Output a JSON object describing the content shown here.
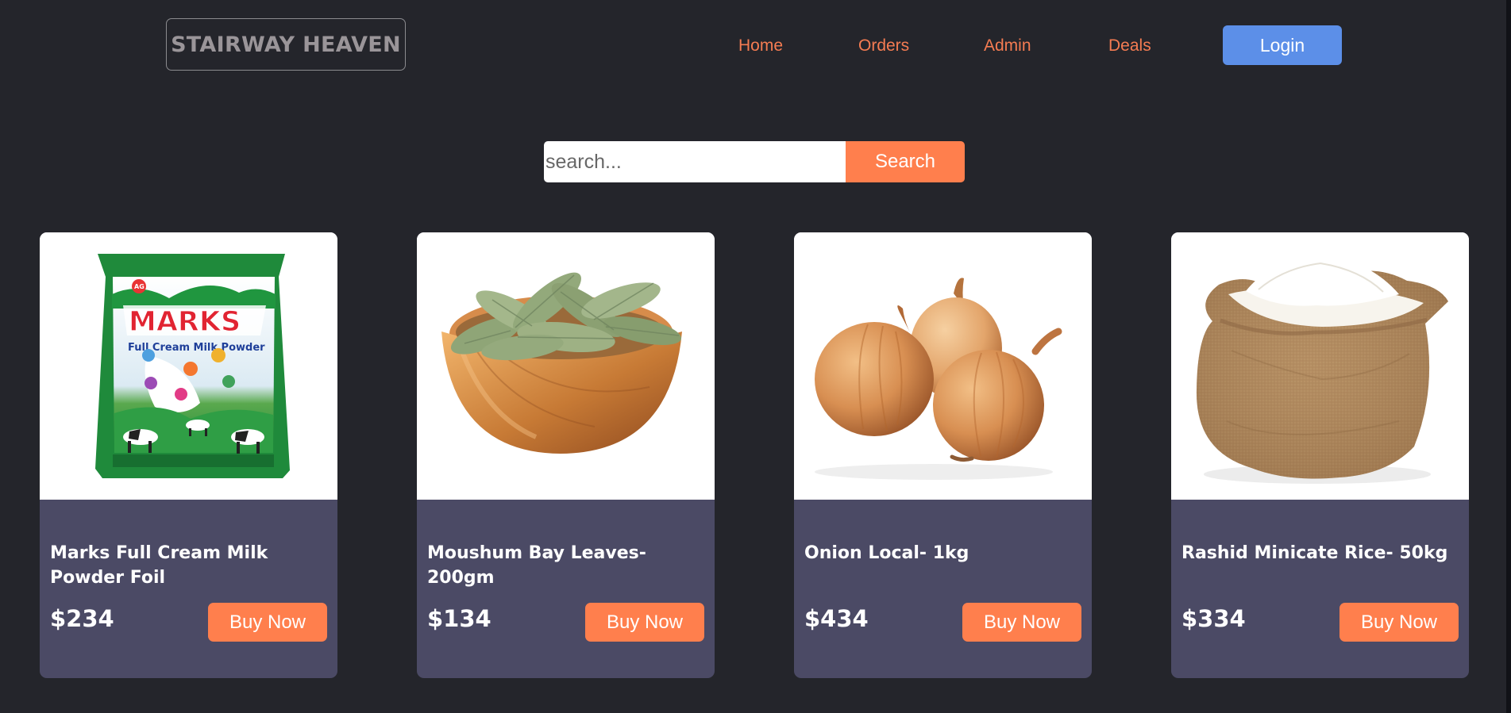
{
  "header": {
    "brand": "STAIRWAY HEAVEN",
    "nav": [
      "Home",
      "Orders",
      "Admin",
      "Deals"
    ],
    "login_label": "Login"
  },
  "search": {
    "placeholder": "search...",
    "button_label": "Search"
  },
  "products": [
    {
      "name": "Marks Full Cream Milk Powder Foil",
      "price": "$234",
      "buy_label": "Buy Now",
      "image": "milk-powder-pack-image",
      "package_brand": "MARKS",
      "package_subtitle": "Full Cream Milk Powder"
    },
    {
      "name": "Moushum Bay Leaves- 200gm",
      "price": "$134",
      "buy_label": "Buy Now",
      "image": "bay-leaves-bowl-image"
    },
    {
      "name": "Onion Local- 1kg",
      "price": "$434",
      "buy_label": "Buy Now",
      "image": "onions-image"
    },
    {
      "name": "Rashid Minicate Rice- 50kg",
      "price": "$334",
      "buy_label": "Buy Now",
      "image": "rice-sack-image"
    }
  ],
  "colors": {
    "background": "#24252b",
    "card": "#4b4a65",
    "accent": "#ff7f4d",
    "nav_text": "#f57c52",
    "login": "#5c8fe8"
  }
}
